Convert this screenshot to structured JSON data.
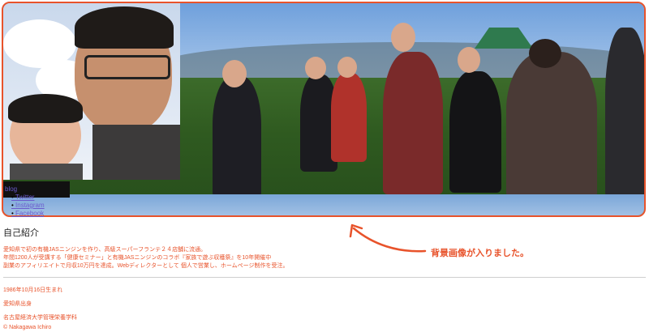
{
  "nav": {
    "blog": "blog",
    "items": [
      "Twitter",
      "Instagram",
      "Facebook"
    ]
  },
  "profile": {
    "heading": "自己紹介",
    "intro_lines": [
      "愛知県で初の有機JASニンジンを作り、高級スーパーフランテ２４店舗に流通。",
      "年間1200人が受講する「健康セミナー」と有機JASニンジンのコラボ『家族で遊ぶ収穫祭』を10年開催中",
      "副業のアフィリエイトで月収10万円を達成。Webディレクターとして 個人で営業し、ホームページ制作を受注。"
    ],
    "facts": [
      "1986年10月16日生まれ",
      "愛知県出身",
      "名古屋経済大学管理栄養学科"
    ],
    "copyright": "© Nakagawa Ichiro"
  },
  "annotation": {
    "text": "背景画像が入りました。"
  },
  "colors": {
    "accent": "#e8532b",
    "link": "#6a5acd"
  }
}
